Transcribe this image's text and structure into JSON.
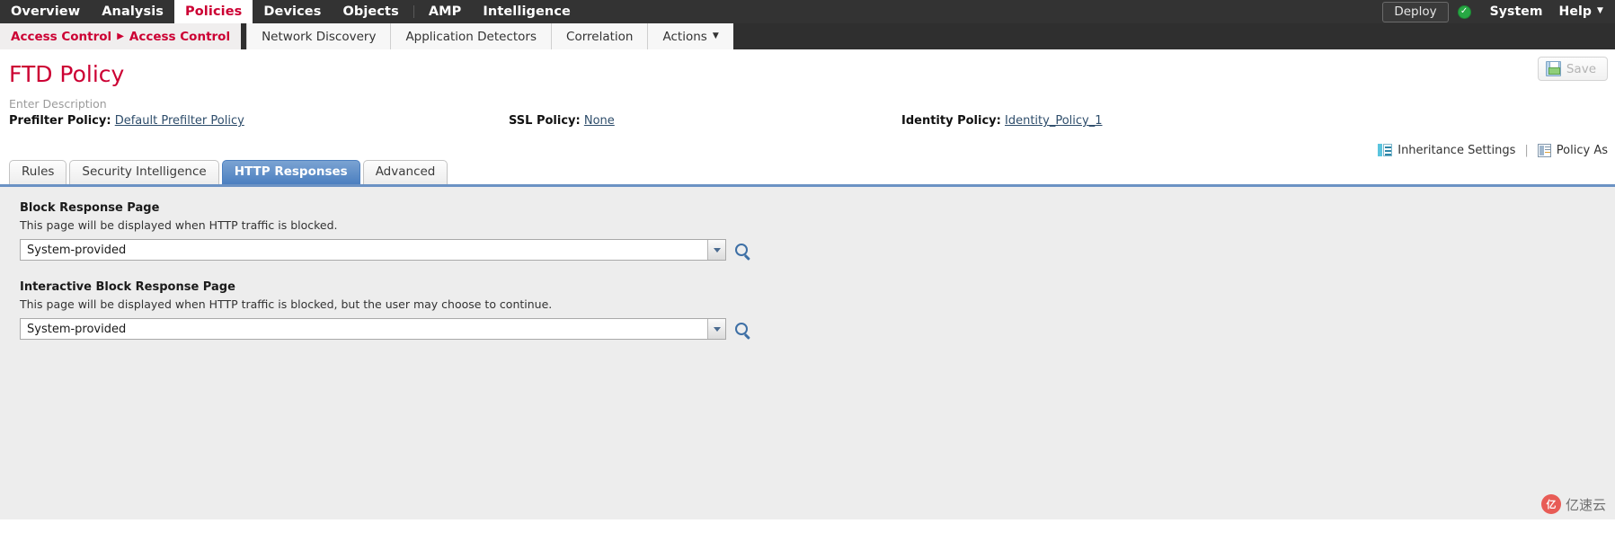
{
  "topnav": {
    "items": [
      {
        "label": "Overview",
        "active": false
      },
      {
        "label": "Analysis",
        "active": false
      },
      {
        "label": "Policies",
        "active": true
      },
      {
        "label": "Devices",
        "active": false
      },
      {
        "label": "Objects",
        "active": false
      },
      {
        "label": "AMP",
        "active": false
      },
      {
        "label": "Intelligence",
        "active": false
      }
    ],
    "deploy_label": "Deploy",
    "status_icon": "check-circle-icon",
    "system_label": "System",
    "help_label": "Help",
    "help_caret": "▼"
  },
  "subnav": {
    "breadcrumb": {
      "parent": "Access Control",
      "arrow": "▶",
      "current": "Access Control"
    },
    "tabs": [
      {
        "label": "Network Discovery",
        "caret": ""
      },
      {
        "label": "Application Detectors",
        "caret": ""
      },
      {
        "label": "Correlation",
        "caret": ""
      },
      {
        "label": "Actions",
        "caret": "▼"
      }
    ]
  },
  "header": {
    "title": "FTD Policy",
    "description": "Enter Description",
    "save_label": "Save",
    "save_icon": "floppy-disk-icon"
  },
  "policies": {
    "prefilter_label": "Prefilter Policy:",
    "prefilter_value": "Default Prefilter Policy",
    "ssl_label": "SSL Policy:",
    "ssl_value": "None",
    "identity_label": "Identity Policy:",
    "identity_value": "Identity_Policy_1"
  },
  "settings_links": {
    "inheritance_icon": "inheritance-icon",
    "inheritance_label": "Inheritance Settings",
    "divider": "|",
    "assignments_icon": "policy-assignments-icon",
    "assignments_label": "Policy As"
  },
  "tabs": [
    {
      "label": "Rules",
      "active": false
    },
    {
      "label": "Security Intelligence",
      "active": false
    },
    {
      "label": "HTTP Responses",
      "active": true
    },
    {
      "label": "Advanced",
      "active": false
    }
  ],
  "form": {
    "block": {
      "title": "Block Response Page",
      "description": "This page will be displayed when HTTP traffic is blocked.",
      "value": "System-provided",
      "dropdown_icon": "chevron-down-icon",
      "search_icon": "magnifier-icon"
    },
    "interactive": {
      "title": "Interactive Block Response Page",
      "description": "This page will be displayed when HTTP traffic is blocked, but the user may choose to continue.",
      "value": "System-provided",
      "dropdown_icon": "chevron-down-icon",
      "search_icon": "magnifier-icon"
    }
  },
  "watermark": {
    "badge": "亿",
    "text": "亿速云"
  },
  "colors": {
    "accent_red": "#cc0033",
    "nav_dark": "#333333",
    "tab_blue": "#4b7fc0",
    "link_blue": "#2e4d6b",
    "content_bg": "#ededed"
  }
}
